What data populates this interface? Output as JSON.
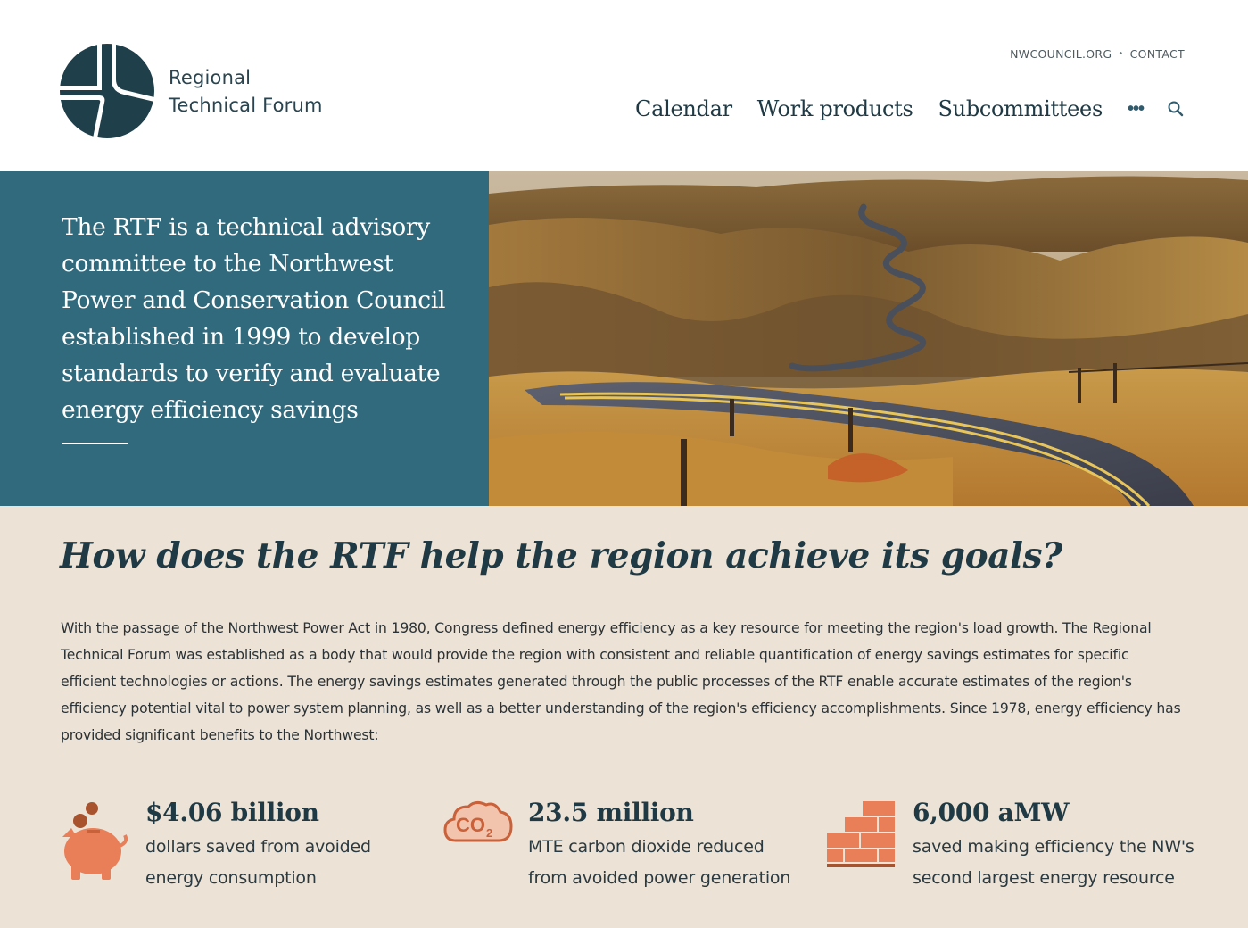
{
  "brand": {
    "name_line1": "Regional",
    "name_line2": "Technical Forum",
    "logo_color": "#1f3f4a"
  },
  "utility_links": {
    "site": "NWCOUNCIL.ORG",
    "separator": "•",
    "contact": "CONTACT"
  },
  "nav": {
    "items": [
      "Calendar",
      "Work products",
      "Subcommittees"
    ],
    "more": "•••",
    "search_icon": "search-icon"
  },
  "hero": {
    "text": "The RTF is a technical advisory committee to the Northwest Power and Conservation Council established in 1999 to develop standards to verify and evaluate energy efficiency savings",
    "panel_color": "#316a7c",
    "image": "winding-road-landscape"
  },
  "section": {
    "title": "How does the RTF help the region achieve its goals?",
    "body": "With the passage of the Northwest Power Act in 1980, Congress defined energy efficiency as a key resource for meeting the region's load growth. The Regional Technical Forum was established as a body that would provide the region with consistent and reliable quantification of energy savings estimates for specific efficient technologies or actions. The energy savings estimates generated through the public processes of the RTF enable accurate estimates of the region's efficiency potential vital to power system planning, as well as a better understanding of the region's efficiency accomplishments. Since 1978, energy efficiency has provided significant benefits to the Northwest:",
    "background": "#ede2d6"
  },
  "stats": [
    {
      "icon": "piggy-bank-icon",
      "value": "$4.06 billion",
      "line1": "dollars saved from avoided",
      "line2": "energy consumption"
    },
    {
      "icon": "co2-cloud-icon",
      "icon_text": "CO",
      "icon_sub": "2",
      "value": "23.5 million",
      "line1": "MTE carbon dioxide reduced",
      "line2": "from avoided power generation"
    },
    {
      "icon": "bricks-icon",
      "value": "6,000 aMW",
      "line1": "saved making efficiency the NW's",
      "line2": "second largest energy resource"
    }
  ],
  "accent_color": "#e87f58"
}
